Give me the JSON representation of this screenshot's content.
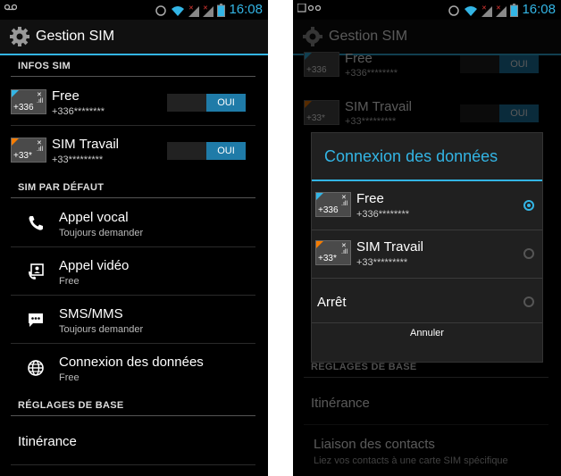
{
  "status": {
    "left_icon": "voicemail-icon",
    "time": "16:08"
  },
  "left": {
    "app_title": "Gestion SIM",
    "section_infos": "INFOS SIM",
    "sims": [
      {
        "badge": "+336",
        "name": "Free",
        "number": "+336********",
        "toggle": "OUI",
        "accent": "#33b5e5"
      },
      {
        "badge": "+33*",
        "name": "SIM Travail",
        "number": "+33*********",
        "toggle": "OUI",
        "accent": "#f57c00"
      }
    ],
    "section_default": "SIM PAR DÉFAUT",
    "items": [
      {
        "title": "Appel vocal",
        "subtitle": "Toujours demander",
        "icon": "phone-icon"
      },
      {
        "title": "Appel vidéo",
        "subtitle": "Free",
        "icon": "video-call-icon"
      },
      {
        "title": "SMS/MMS",
        "subtitle": "Toujours demander",
        "icon": "message-icon"
      },
      {
        "title": "Connexion des données",
        "subtitle": "Free",
        "icon": "globe-icon"
      }
    ],
    "section_base": "RÉGLAGES DE BASE",
    "roaming": "Itinérance"
  },
  "right": {
    "app_title": "Gestion SIM",
    "bg_sims": [
      {
        "badge": "+336",
        "name": "Free",
        "number": "+336********",
        "toggle": "OUI"
      },
      {
        "badge": "+33*",
        "name": "SIM Travail",
        "number": "+33*********",
        "toggle": "OUI"
      }
    ],
    "section_base": "RÉGLAGES DE BASE",
    "roaming": "Itinérance",
    "contacts_title": "Liaison des contacts",
    "contacts_sub": "Liez vos contacts à une carte SIM spécifique",
    "dialog": {
      "title": "Connexion des données",
      "options": [
        {
          "badge": "+336",
          "name": "Free",
          "number": "+336********",
          "selected": true
        },
        {
          "badge": "+33*",
          "name": "SIM Travail",
          "number": "+33*********",
          "selected": false
        }
      ],
      "off_label": "Arrêt",
      "cancel": "Annuler"
    }
  },
  "colors": {
    "accent": "#33b5e5",
    "sim2": "#f57c00",
    "toggle_on": "#1f7ba8"
  }
}
